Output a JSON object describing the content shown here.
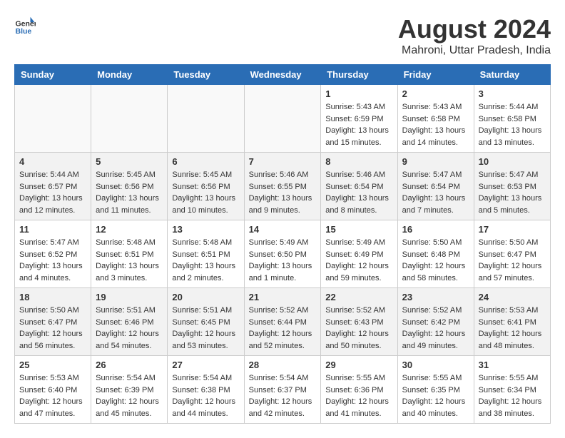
{
  "header": {
    "logo_general": "General",
    "logo_blue": "Blue",
    "title": "August 2024",
    "subtitle": "Mahroni, Uttar Pradesh, India"
  },
  "calendar": {
    "days_of_week": [
      "Sunday",
      "Monday",
      "Tuesday",
      "Wednesday",
      "Thursday",
      "Friday",
      "Saturday"
    ],
    "weeks": [
      [
        {
          "day": "",
          "info": ""
        },
        {
          "day": "",
          "info": ""
        },
        {
          "day": "",
          "info": ""
        },
        {
          "day": "",
          "info": ""
        },
        {
          "day": "1",
          "sunrise": "5:43 AM",
          "sunset": "6:59 PM",
          "daylight": "13 hours and 15 minutes."
        },
        {
          "day": "2",
          "sunrise": "5:43 AM",
          "sunset": "6:58 PM",
          "daylight": "13 hours and 14 minutes."
        },
        {
          "day": "3",
          "sunrise": "5:44 AM",
          "sunset": "6:58 PM",
          "daylight": "13 hours and 13 minutes."
        }
      ],
      [
        {
          "day": "4",
          "sunrise": "5:44 AM",
          "sunset": "6:57 PM",
          "daylight": "13 hours and 12 minutes."
        },
        {
          "day": "5",
          "sunrise": "5:45 AM",
          "sunset": "6:56 PM",
          "daylight": "13 hours and 11 minutes."
        },
        {
          "day": "6",
          "sunrise": "5:45 AM",
          "sunset": "6:56 PM",
          "daylight": "13 hours and 10 minutes."
        },
        {
          "day": "7",
          "sunrise": "5:46 AM",
          "sunset": "6:55 PM",
          "daylight": "13 hours and 9 minutes."
        },
        {
          "day": "8",
          "sunrise": "5:46 AM",
          "sunset": "6:54 PM",
          "daylight": "13 hours and 8 minutes."
        },
        {
          "day": "9",
          "sunrise": "5:47 AM",
          "sunset": "6:54 PM",
          "daylight": "13 hours and 7 minutes."
        },
        {
          "day": "10",
          "sunrise": "5:47 AM",
          "sunset": "6:53 PM",
          "daylight": "13 hours and 5 minutes."
        }
      ],
      [
        {
          "day": "11",
          "sunrise": "5:47 AM",
          "sunset": "6:52 PM",
          "daylight": "13 hours and 4 minutes."
        },
        {
          "day": "12",
          "sunrise": "5:48 AM",
          "sunset": "6:51 PM",
          "daylight": "13 hours and 3 minutes."
        },
        {
          "day": "13",
          "sunrise": "5:48 AM",
          "sunset": "6:51 PM",
          "daylight": "13 hours and 2 minutes."
        },
        {
          "day": "14",
          "sunrise": "5:49 AM",
          "sunset": "6:50 PM",
          "daylight": "13 hours and 1 minute."
        },
        {
          "day": "15",
          "sunrise": "5:49 AM",
          "sunset": "6:49 PM",
          "daylight": "12 hours and 59 minutes."
        },
        {
          "day": "16",
          "sunrise": "5:50 AM",
          "sunset": "6:48 PM",
          "daylight": "12 hours and 58 minutes."
        },
        {
          "day": "17",
          "sunrise": "5:50 AM",
          "sunset": "6:47 PM",
          "daylight": "12 hours and 57 minutes."
        }
      ],
      [
        {
          "day": "18",
          "sunrise": "5:50 AM",
          "sunset": "6:47 PM",
          "daylight": "12 hours and 56 minutes."
        },
        {
          "day": "19",
          "sunrise": "5:51 AM",
          "sunset": "6:46 PM",
          "daylight": "12 hours and 54 minutes."
        },
        {
          "day": "20",
          "sunrise": "5:51 AM",
          "sunset": "6:45 PM",
          "daylight": "12 hours and 53 minutes."
        },
        {
          "day": "21",
          "sunrise": "5:52 AM",
          "sunset": "6:44 PM",
          "daylight": "12 hours and 52 minutes."
        },
        {
          "day": "22",
          "sunrise": "5:52 AM",
          "sunset": "6:43 PM",
          "daylight": "12 hours and 50 minutes."
        },
        {
          "day": "23",
          "sunrise": "5:52 AM",
          "sunset": "6:42 PM",
          "daylight": "12 hours and 49 minutes."
        },
        {
          "day": "24",
          "sunrise": "5:53 AM",
          "sunset": "6:41 PM",
          "daylight": "12 hours and 48 minutes."
        }
      ],
      [
        {
          "day": "25",
          "sunrise": "5:53 AM",
          "sunset": "6:40 PM",
          "daylight": "12 hours and 47 minutes."
        },
        {
          "day": "26",
          "sunrise": "5:54 AM",
          "sunset": "6:39 PM",
          "daylight": "12 hours and 45 minutes."
        },
        {
          "day": "27",
          "sunrise": "5:54 AM",
          "sunset": "6:38 PM",
          "daylight": "12 hours and 44 minutes."
        },
        {
          "day": "28",
          "sunrise": "5:54 AM",
          "sunset": "6:37 PM",
          "daylight": "12 hours and 42 minutes."
        },
        {
          "day": "29",
          "sunrise": "5:55 AM",
          "sunset": "6:36 PM",
          "daylight": "12 hours and 41 minutes."
        },
        {
          "day": "30",
          "sunrise": "5:55 AM",
          "sunset": "6:35 PM",
          "daylight": "12 hours and 40 minutes."
        },
        {
          "day": "31",
          "sunrise": "5:55 AM",
          "sunset": "6:34 PM",
          "daylight": "12 hours and 38 minutes."
        }
      ]
    ]
  }
}
